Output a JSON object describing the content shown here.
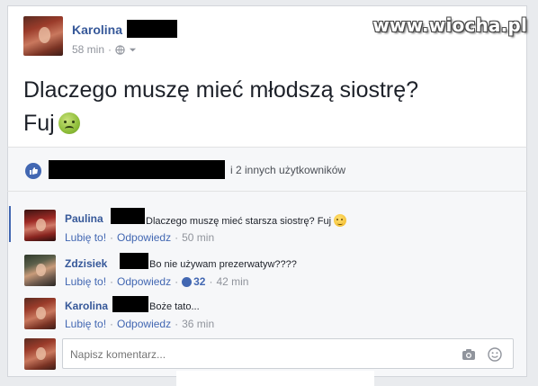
{
  "watermark": "www.wiocha.pl",
  "post": {
    "author": "Karolina",
    "time": "58 min",
    "text_line1": "Dlaczego muszę mieć młodszą siostrę?",
    "text_line2": "Fuj",
    "emoji": "nauseated-face"
  },
  "reactions": {
    "icon": "like-icon",
    "suffix": "i 2 innych użytkowników"
  },
  "comments": [
    {
      "author": "Paulina",
      "text": "Dlaczego muszę mieć starsza siostrę? Fuj",
      "emoji": "smirk-face",
      "like": "Lubię to!",
      "reply": "Odpowiedz",
      "time": "50 min"
    },
    {
      "author": "Zdzisiek",
      "text": "Bo nie używam prezerwatyw????",
      "like": "Lubię to!",
      "reply": "Odpowiedz",
      "reaction_count": "32",
      "time": "42 min"
    },
    {
      "author": "Karolina",
      "text": "Boże tato...",
      "like": "Lubię to!",
      "reply": "Odpowiedz",
      "time": "36 min"
    }
  ],
  "composer": {
    "placeholder": "Napisz komentarz..."
  },
  "colors": {
    "link": "#365899",
    "accent": "#4267b2",
    "muted": "#90949c",
    "background": "#e9ebee"
  }
}
